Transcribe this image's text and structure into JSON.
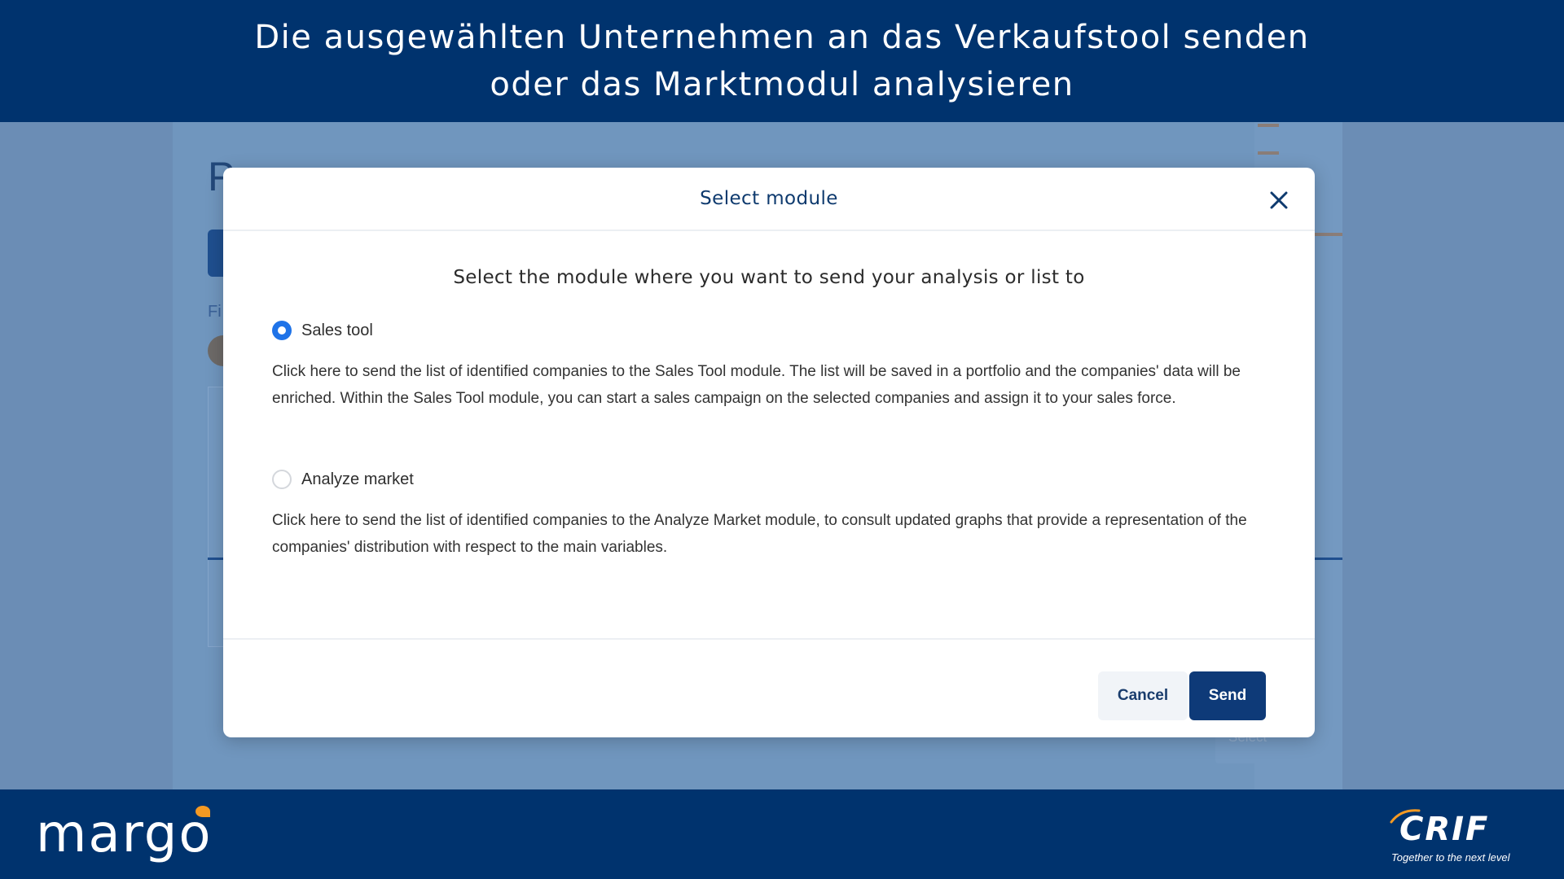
{
  "banner": {
    "line1": "Die ausgewählten Unternehmen an das Verkaufstool senden",
    "line2": "oder das Marktmodul analysieren"
  },
  "background": {
    "page_title_fragment": "P",
    "filter_label_fragment": "Fi",
    "select_placeholder": "Select"
  },
  "modal": {
    "title": "Select module",
    "subtitle": "Select the module where you want to send your analysis or list to",
    "options": [
      {
        "label": "Sales tool",
        "selected": true,
        "description": "Click here to send the list of identified companies to the Sales Tool module. The list will be saved in a portfolio and the companies' data will be enriched. Within the Sales Tool module, you can start a sales campaign on the selected companies and assign it to your sales force."
      },
      {
        "label": "Analyze market",
        "selected": false,
        "description": "Click here to send the list of identified companies to the Analyze Market module, to consult updated graphs that provide a representation of the companies' distribution with respect to the main variables."
      }
    ],
    "cancel_label": "Cancel",
    "send_label": "Send"
  },
  "footer": {
    "margo_logo": "margo",
    "crif_logo": "CRIF",
    "crif_tagline": "Together to the next level"
  },
  "colors": {
    "banner_bg": "#00336e",
    "primary_button": "#0e3a78",
    "radio_selected": "#1f73e8",
    "margo_accent": "#f59a23",
    "overlay_bg": "#6b8db5"
  },
  "icons": {
    "close": "close-icon",
    "radio_selected": "radio-checked-icon",
    "radio_unselected": "radio-unchecked-icon"
  }
}
